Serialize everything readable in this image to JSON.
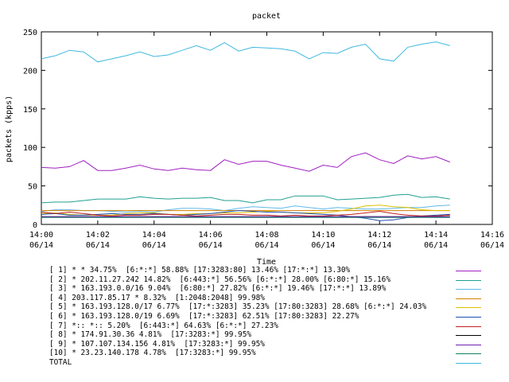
{
  "chart_data": {
    "type": "line",
    "title": "packet",
    "xlabel": "Time",
    "ylabel": "packets (kpps)",
    "ylim": [
      0,
      250
    ],
    "yticks": [
      0,
      50,
      100,
      150,
      200,
      250
    ],
    "xlim": [
      "14:00",
      "14:16"
    ],
    "xticks": [
      {
        "time": "14:00",
        "date": "06/14"
      },
      {
        "time": "14:02",
        "date": "06/14"
      },
      {
        "time": "14:04",
        "date": "06/14"
      },
      {
        "time": "14:06",
        "date": "06/14"
      },
      {
        "time": "14:08",
        "date": "06/14"
      },
      {
        "time": "14:10",
        "date": "06/14"
      },
      {
        "time": "14:12",
        "date": "06/14"
      },
      {
        "time": "14:14",
        "date": "06/14"
      },
      {
        "time": "14:16",
        "date": "06/14"
      }
    ],
    "x": [
      "14:00",
      "14:00:30",
      "14:01",
      "14:01:30",
      "14:02",
      "14:02:30",
      "14:03",
      "14:03:30",
      "14:04",
      "14:04:30",
      "14:05",
      "14:05:30",
      "14:06",
      "14:06:30",
      "14:07",
      "14:07:30",
      "14:08",
      "14:08:30",
      "14:09",
      "14:09:30",
      "14:10",
      "14:10:30",
      "14:11",
      "14:11:30",
      "14:12",
      "14:12:30",
      "14:13",
      "14:13:30",
      "14:14",
      "14:14:30"
    ],
    "grid": false,
    "legend_position": "bottom",
    "series": [
      {
        "name": "[ 1] * * 34.75%  [6:*:*] 58.88% [17:3283:80] 13.46% [17:*:*] 13.30%",
        "color": "#a020c0",
        "values": [
          74,
          73,
          75,
          83,
          70,
          70,
          73,
          77,
          72,
          70,
          73,
          71,
          70,
          84,
          78,
          82,
          82,
          77,
          73,
          69,
          77,
          74,
          88,
          93,
          84,
          79,
          89,
          85,
          88,
          81
        ]
      },
      {
        "name": "[ 2] * 202.11.27.242 14.82%  [6:443:*] 56.56% [6:*:*] 28.00% [6:80:*] 15.16%",
        "color": "#20a090",
        "values": [
          28,
          29,
          29,
          31,
          33,
          33,
          33,
          36,
          34,
          33,
          34,
          34,
          35,
          31,
          31,
          28,
          32,
          32,
          37,
          37,
          37,
          32,
          33,
          34,
          35,
          38,
          39,
          35,
          36,
          33
        ]
      },
      {
        "name": "[ 3] * 163.193.0.0/16 9.04%  [6:80:*] 27.82% [6:*:*] 19.46% [17:*:*] 13.89%",
        "color": "#60b8e8",
        "values": [
          17,
          19,
          19,
          18,
          18,
          17,
          16,
          17,
          16,
          19,
          21,
          21,
          20,
          18,
          21,
          23,
          22,
          21,
          24,
          22,
          20,
          22,
          21,
          20,
          20,
          21,
          22,
          22,
          24,
          25
        ]
      },
      {
        "name": "[ 4] 203.117.85.17 * 8.32%  [1:2048:2048] 99.98%",
        "color": "#d08000",
        "values": [
          18,
          18,
          18,
          18,
          18,
          18,
          18,
          18,
          18,
          18,
          18,
          18,
          18,
          18,
          18,
          18,
          18,
          18,
          18,
          18,
          18,
          18,
          18,
          18,
          18,
          18,
          18,
          18,
          18,
          18
        ]
      },
      {
        "name": "[ 5] * 163.193.128.0/17 6.77%  [17:*:3283] 35.23% [17:80:3283] 28.68% [6:*:*] 24.03%",
        "color": "#e0c000",
        "values": [
          14,
          15,
          13,
          12,
          12,
          12,
          14,
          15,
          15,
          13,
          13,
          14,
          14,
          15,
          15,
          16,
          17,
          16,
          15,
          15,
          15,
          17,
          20,
          24,
          25,
          23,
          22,
          19,
          18,
          18
        ]
      },
      {
        "name": "[ 6] * 163.193.128.0/19 6.69%  [17:*:3283] 62.51% [17:80:3283] 22.27%",
        "color": "#2050b0",
        "values": [
          13,
          14,
          12,
          12,
          13,
          14,
          13,
          13,
          14,
          13,
          12,
          13,
          14,
          16,
          18,
          17,
          16,
          16,
          15,
          14,
          13,
          12,
          10,
          8,
          5,
          6,
          9,
          11,
          12,
          13
        ]
      },
      {
        "name": "[ 7] *:: *:: 5.20%  [6:443:*] 64.63% [6:*:*] 27.23%",
        "color": "#c02020",
        "values": [
          16,
          14,
          16,
          14,
          12,
          11,
          12,
          12,
          13,
          13,
          12,
          11,
          12,
          13,
          13,
          12,
          12,
          11,
          12,
          11,
          11,
          12,
          13,
          15,
          17,
          14,
          12,
          11,
          11,
          12
        ]
      },
      {
        "name": "[ 8] * 174.91.30.36 4.81%  [17:3283:*] 99.95%",
        "color": "#000000",
        "values": [
          10,
          10,
          10,
          10,
          10,
          10,
          10,
          10,
          10,
          10,
          10,
          10,
          10,
          10,
          10,
          10,
          10,
          10,
          10,
          10,
          10,
          10,
          10,
          10,
          10,
          10,
          10,
          10,
          10,
          10
        ]
      },
      {
        "name": "[ 9] * 107.107.134.156 4.81%  [17:3283:*] 99.95%",
        "color": "#7020b0",
        "values": [
          10,
          10,
          10,
          10,
          10,
          10,
          10,
          10,
          10,
          10,
          10,
          10,
          10,
          10,
          10,
          10,
          10,
          10,
          10,
          10,
          10,
          10,
          10,
          10,
          10,
          10,
          10,
          10,
          10,
          10
        ]
      },
      {
        "name": "[10] * 23.23.140.178 4.78%  [17:3283:*] 99.95%",
        "color": "#108060",
        "values": [
          9,
          9,
          9,
          9,
          9,
          9,
          9,
          9,
          9,
          9,
          9,
          9,
          9,
          9,
          9,
          9,
          9,
          9,
          9,
          9,
          9,
          9,
          9,
          9,
          9,
          9,
          9,
          9,
          9,
          9
        ]
      },
      {
        "name": "TOTAL",
        "color": "#40b8e0",
        "values": [
          215,
          219,
          226,
          224,
          211,
          215,
          219,
          224,
          218,
          220,
          226,
          232,
          226,
          236,
          225,
          230,
          229,
          228,
          225,
          215,
          223,
          222,
          230,
          234,
          215,
          212,
          230,
          234,
          237,
          232
        ]
      }
    ]
  }
}
